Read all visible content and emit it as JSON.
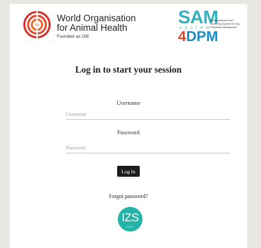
{
  "header": {
    "oie_line1": "World Organisation",
    "oie_line2": "for Animal Health",
    "oie_founded": "Founded as OIE",
    "sam_word": "SAM",
    "sam_system": "system",
    "sam_4": "4",
    "sam_dpm": "DPM",
    "sam_tag": "Self Assessment and Monitoring System for Dog Population Management"
  },
  "title": "Log in to start your session",
  "username": {
    "label": "Username",
    "placeholder": "Username"
  },
  "password": {
    "label": "Password",
    "placeholder": "Password"
  },
  "login_button": "Log In",
  "forgot_link": "Forgot password?",
  "footer_logo": {
    "text": "IZS",
    "sub": "Teramo"
  },
  "colors": {
    "sam_teal": "#34b1bd",
    "dpm_red": "#e0472b",
    "dpm_blue": "#1d8dc9",
    "oie_red": "#d3312b",
    "izs_teal": "#23b3a8",
    "button_bg": "#1c1c1c"
  }
}
